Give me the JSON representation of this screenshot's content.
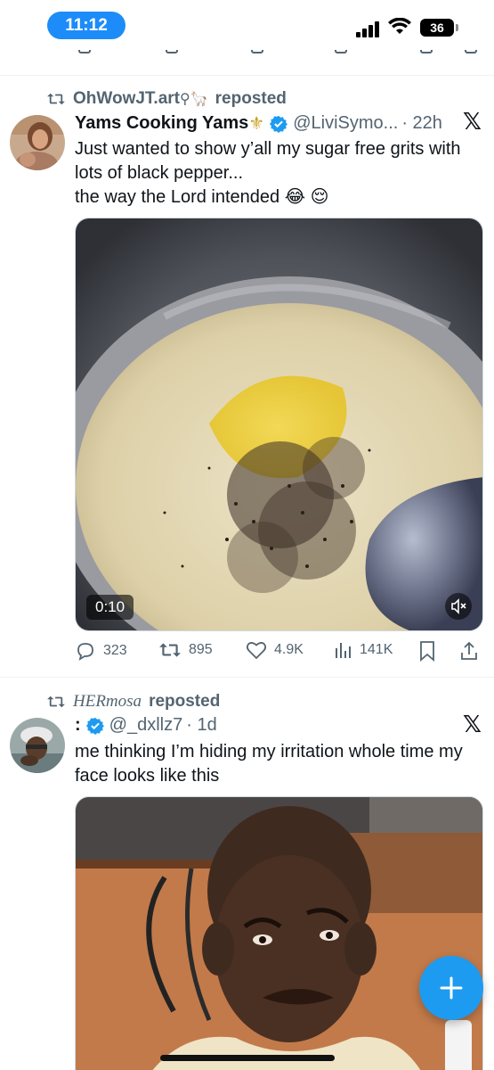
{
  "status_bar": {
    "time": "11:12",
    "battery": "36"
  },
  "colors": {
    "accent": "#1d9bf0",
    "text": "#0f1419",
    "muted": "#536471"
  },
  "tweets": [
    {
      "repost_by": "OhWowJT.art",
      "repost_emoji": "⚲🦙",
      "repost_label": "reposted",
      "name": "Yams Cooking Yams",
      "name_emoji": "⚜",
      "handle": "@LiviSymo...",
      "time": "· 22h",
      "text_line1": "Just wanted to show y’all my sugar free grits with",
      "text_line2": "lots of black pepper...",
      "text_line3": "the way the Lord intended 😂 😌",
      "video_time": "0:10",
      "stats": {
        "replies": "323",
        "reposts": "895",
        "likes": "4.9K",
        "views": "141K"
      }
    },
    {
      "repost_by": "HERmosa",
      "repost_label": "reposted",
      "name": ":",
      "handle": "@_dxllz7",
      "time": "· 1d",
      "text_line1": "me thinking I’m hiding my irritation whole time my",
      "text_line2": "face looks like this"
    }
  ],
  "icons": [
    "retweet-icon",
    "verified-badge-icon",
    "x-logo-icon",
    "reply-icon",
    "like-icon",
    "views-icon",
    "bookmark-icon",
    "share-icon",
    "mute-icon",
    "compose-icon"
  ]
}
